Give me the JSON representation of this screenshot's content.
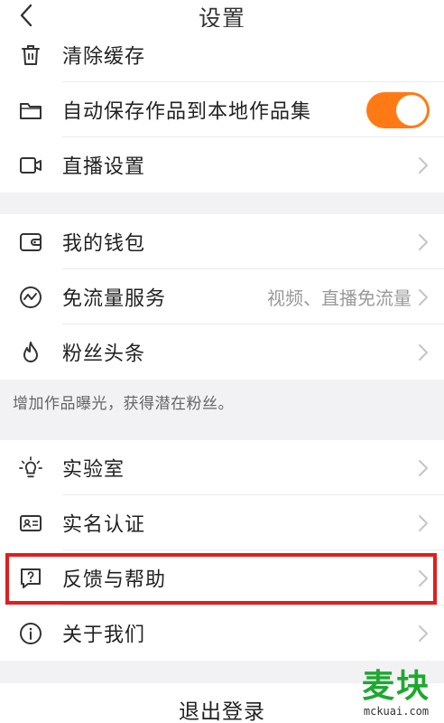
{
  "header": {
    "title": "设置"
  },
  "group1": {
    "items": [
      {
        "label": "清除缓存",
        "icon": "trash-icon"
      },
      {
        "label": "自动保存作品到本地作品集",
        "icon": "folder-icon",
        "toggle_on": true
      },
      {
        "label": "直播设置",
        "icon": "video-camera-icon"
      }
    ]
  },
  "group2": {
    "items": [
      {
        "label": "我的钱包",
        "icon": "wallet-icon"
      },
      {
        "label": "免流量服务",
        "icon": "data-wave-icon",
        "value": "视频、直播免流量"
      },
      {
        "label": "粉丝头条",
        "icon": "flame-icon"
      }
    ],
    "hint": "增加作品曝光，获得潜在粉丝。"
  },
  "group3": {
    "items": [
      {
        "label": "实验室",
        "icon": "lightbulb-icon"
      },
      {
        "label": "实名认证",
        "icon": "id-card-icon"
      },
      {
        "label": "反馈与帮助",
        "icon": "help-icon",
        "highlighted": true
      },
      {
        "label": "关于我们",
        "icon": "info-icon"
      }
    ]
  },
  "logout": {
    "label": "退出登录"
  },
  "watermark": {
    "text": "麦块",
    "sub": "mckuai.com"
  },
  "colors": {
    "accent": "#ff7a14",
    "highlight": "#e01e1e",
    "watermark": "#1ea830"
  }
}
